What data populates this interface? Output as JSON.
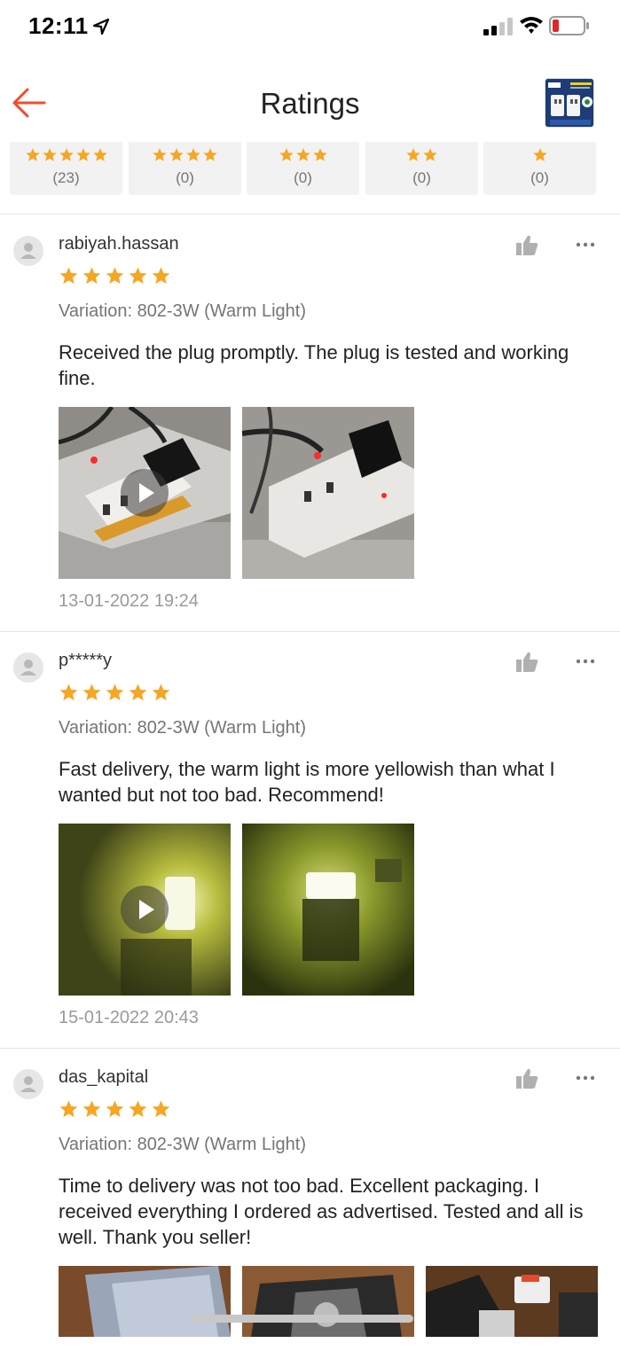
{
  "status_bar": {
    "time": "12:11"
  },
  "header": {
    "title": "Ratings",
    "product_thumb_icon": "product-image"
  },
  "filters": [
    {
      "stars": 5,
      "count": "(23)"
    },
    {
      "stars": 4,
      "count": "(0)"
    },
    {
      "stars": 3,
      "count": "(0)"
    },
    {
      "stars": 2,
      "count": "(0)"
    },
    {
      "stars": 1,
      "count": "(0)"
    }
  ],
  "colors": {
    "accent": "#ee4d2d",
    "star": "#f5a623",
    "chip_bg": "#f2f2f2"
  },
  "reviews": [
    {
      "username": "rabiyah.hassan",
      "rating": 5,
      "variation": "Variation: 802-3W (Warm Light)",
      "text": "Received the plug promptly. The plug is tested and working fine.",
      "media": [
        "video",
        "photo"
      ],
      "timestamp": "13-01-2022 19:24"
    },
    {
      "username": "p*****y",
      "rating": 5,
      "variation": "Variation: 802-3W (Warm Light)",
      "text": "Fast delivery, the warm light is more yellowish than what I wanted  but not too bad. Recommend!",
      "media": [
        "video",
        "photo"
      ],
      "timestamp": "15-01-2022 20:43"
    },
    {
      "username": "das_kapital",
      "rating": 5,
      "variation": "Variation: 802-3W (Warm Light)",
      "text": "Time to delivery was not too bad. Excellent packaging. I received everything I ordered as advertised. Tested and all is well. Thank you seller!",
      "media": [
        "photo",
        "photo",
        "photo"
      ]
    }
  ]
}
